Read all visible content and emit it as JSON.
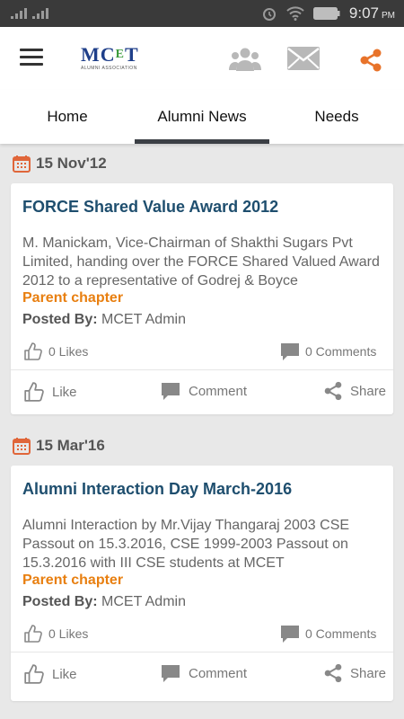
{
  "status_bar": {
    "time": "9:07",
    "ampm": "PM"
  },
  "app": {
    "logo_text_left": "MC",
    "logo_text_e": "E",
    "logo_text_right": "T",
    "logo_subtitle": "ALUMNI ASSOCIATION"
  },
  "icons": {
    "menu": "hamburger-menu-icon",
    "community": "community-icon",
    "mail": "mail-icon",
    "share": "share-icon"
  },
  "colors": {
    "accent": "#e87f10",
    "title": "#1e4e6e",
    "share_icon": "#e8732a",
    "tab_indicator": "#3b3f45"
  },
  "tabs": [
    {
      "label": "Home",
      "active": false
    },
    {
      "label": "Alumni News",
      "active": true
    },
    {
      "label": "Needs",
      "active": false
    }
  ],
  "posts": [
    {
      "date": "15 Nov'12",
      "title": "FORCE Shared Value Award 2012",
      "description": "M. Manickam, Vice-Chairman of Shakthi Sugars Pvt Limited, handing over the FORCE Shared Valued Award 2012 to a representative of Godrej & Boyce",
      "chapter": "Parent chapter",
      "posted_by_label": "Posted By:",
      "posted_by": "MCET Admin",
      "likes": "0 Likes",
      "comments": "0 Comments",
      "like_label": "Like",
      "comment_label": "Comment",
      "share_label": "Share"
    },
    {
      "date": "15 Mar'16",
      "title": "Alumni Interaction Day March-2016",
      "description": "Alumni Interaction by Mr.Vijay Thangaraj 2003 CSE Passout on 15.3.2016, CSE 1999-2003 Passout on 15.3.2016 with III CSE students at MCET",
      "chapter": "Parent chapter",
      "posted_by_label": "Posted By:",
      "posted_by": "MCET Admin",
      "likes": "0 Likes",
      "comments": "0 Comments",
      "like_label": "Like",
      "comment_label": "Comment",
      "share_label": "Share"
    }
  ]
}
